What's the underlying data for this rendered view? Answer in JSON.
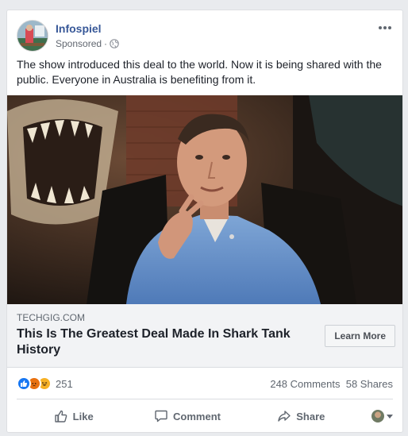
{
  "post": {
    "page_name": "Infospiel",
    "sponsored_label": "Sponsored",
    "separator": "·",
    "body_text": "The show introduced this deal to the world. Now it is being shared with the public. Everyone in Australia is benefiting from it."
  },
  "link_preview": {
    "domain": "TECHGIG.COM",
    "headline": "This Is The Greatest Deal Made In Shark Tank History",
    "cta_label": "Learn More"
  },
  "engagement": {
    "reaction_count": "251",
    "comments_text": "248 Comments",
    "shares_text": "58 Shares",
    "reaction_icons": [
      "like-icon",
      "angry-icon",
      "haha-icon"
    ]
  },
  "actions": {
    "like_label": "Like",
    "comment_label": "Comment",
    "share_label": "Share"
  },
  "colors": {
    "page_name": "#385898",
    "like_blue": "#1877f2",
    "background": "#e9ebee"
  }
}
